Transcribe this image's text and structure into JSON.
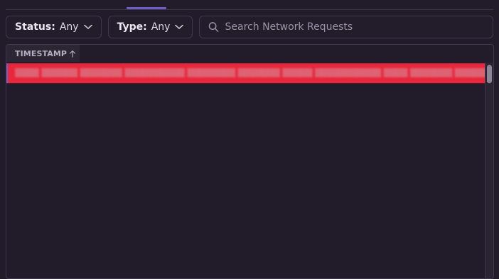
{
  "filters": {
    "status": {
      "label": "Status:",
      "value": "Any"
    },
    "type": {
      "label": "Type:",
      "value": "Any"
    },
    "search": {
      "placeholder": "Search Network Requests",
      "value": ""
    }
  },
  "table": {
    "columns": [
      {
        "label": "TIMESTAMP",
        "sort": "ascending"
      }
    ],
    "rows": [
      {
        "text": "▒▒▒▒ ▒▒▒▒▒▒ ▒▒▒▒▒▒▒ ▒▒▒▒▒▒▒▒▒▒ ▒▒▒▒▒▒▒▒ ▒▒▒▒▒▒▒ ▒▒▒▒▒ ▒▒▒▒▒▒▒▒▒▒▒ ▒▒▒▒ ▒▒▒▒▒▒▒ ▒▒▒▒▒▒▒▒▒ ▒▒▒▒▒▒ ▒▒▒▒▒▒▒▒▒▒ ▒▒▒▒▒▒▒",
        "status": "error",
        "selected": true
      }
    ]
  },
  "colors": {
    "background": "#221c2a",
    "accent": "#6c5fc7",
    "error_row": "#e8263c",
    "border": "#3e3750"
  },
  "icons": {
    "status_dropdown": "chevron-down-icon",
    "type_dropdown": "chevron-down-icon",
    "search": "search-icon",
    "sort": "arrow-up-icon"
  }
}
